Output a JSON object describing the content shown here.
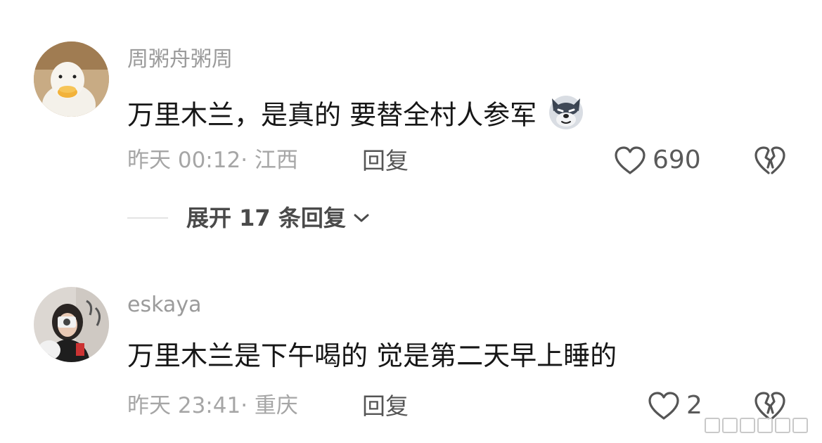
{
  "comments": [
    {
      "username": "周粥舟粥周",
      "text": "万里木兰，是真的 要替全村人参军",
      "inline_emoji": "wolf-face-emoji",
      "timestamp": "昨天 00:12· 江西",
      "reply_label": "回复",
      "like_count": "690",
      "expand_label": "展开 17 条回复"
    },
    {
      "username": "eskaya",
      "text": "万里木兰是下午喝的  觉是第二天早上睡的",
      "timestamp": "昨天 23:41· 重庆",
      "reply_label": "回复",
      "like_count": "2"
    }
  ],
  "icons": {
    "like": "heart-outline-icon",
    "dislike": "broken-heart-icon",
    "expand": "chevron-down-icon"
  },
  "colors": {
    "username": "#9b9b9b",
    "text": "#161616",
    "meta": "#a6a6a6",
    "icon": "#555555"
  }
}
